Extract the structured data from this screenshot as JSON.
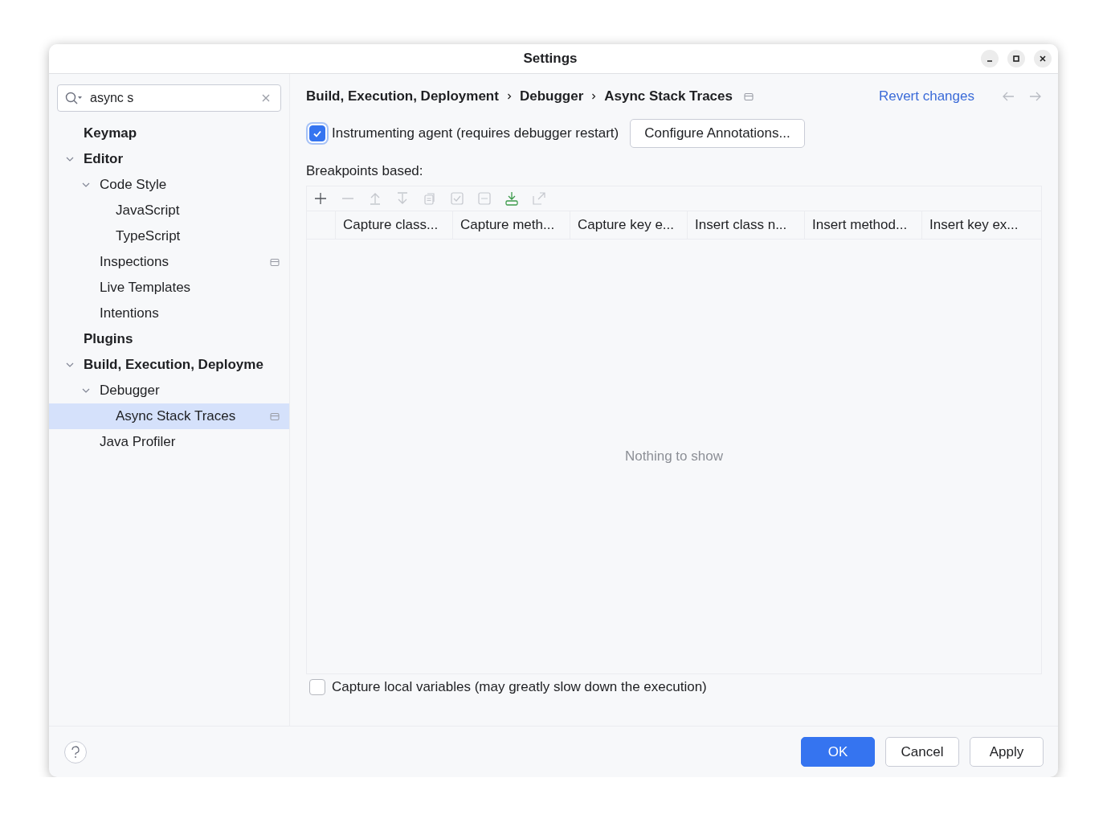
{
  "window": {
    "title": "Settings"
  },
  "search": {
    "value": "async s"
  },
  "sidebar": {
    "items": [
      {
        "label": "Keymap",
        "selected": false,
        "project_marker": false
      },
      {
        "label": "Editor",
        "selected": false,
        "project_marker": false,
        "expanded": true,
        "children": [
          {
            "label": "Code Style",
            "selected": false,
            "project_marker": false,
            "expanded": true,
            "children": [
              {
                "label": "JavaScript",
                "selected": false,
                "project_marker": false
              },
              {
                "label": "TypeScript",
                "selected": false,
                "project_marker": false
              }
            ]
          },
          {
            "label": "Inspections",
            "selected": false,
            "project_marker": true
          },
          {
            "label": "Live Templates",
            "selected": false,
            "project_marker": false
          },
          {
            "label": "Intentions",
            "selected": false,
            "project_marker": false
          }
        ]
      },
      {
        "label": "Plugins",
        "selected": false,
        "project_marker": false
      },
      {
        "label": "Build, Execution, Deployme",
        "selected": false,
        "project_marker": false,
        "expanded": true,
        "children": [
          {
            "label": "Debugger",
            "selected": false,
            "project_marker": false,
            "expanded": true,
            "children": [
              {
                "label": "Async Stack Traces",
                "selected": true,
                "project_marker": true
              }
            ]
          },
          {
            "label": "Java Profiler",
            "selected": false,
            "project_marker": false
          }
        ]
      }
    ]
  },
  "breadcrumb": {
    "items": [
      "Build, Execution, Deployment",
      "Debugger",
      "Async Stack Traces"
    ],
    "project_marker": true
  },
  "revert_link": "Revert changes",
  "nav": [
    {
      "kind": "back",
      "disabled": true
    },
    {
      "kind": "forward",
      "disabled": true
    }
  ],
  "agent_option": {
    "label": "Instrumenting agent (requires debugger restart)",
    "checked": true
  },
  "configure_button": "Configure Annotations...",
  "breakpoints_label": "Breakpoints based:",
  "toolbar": [
    {
      "kind": "add",
      "disabled": false
    },
    {
      "kind": "remove",
      "disabled": true
    },
    {
      "kind": "up",
      "disabled": true
    },
    {
      "kind": "down",
      "disabled": true
    },
    {
      "kind": "copy",
      "disabled": true
    },
    {
      "kind": "check",
      "disabled": true
    },
    {
      "kind": "uncheck",
      "disabled": true
    },
    {
      "kind": "import",
      "disabled": false
    },
    {
      "kind": "export",
      "disabled": true
    }
  ],
  "table": {
    "columns": [
      "Capture class...",
      "Capture meth...",
      "Capture key e...",
      "Insert class n...",
      "Insert method...",
      "Insert key ex..."
    ],
    "empty_text": "Nothing to show"
  },
  "locals_option": {
    "label": "Capture local variables (may greatly slow down the execution)",
    "checked": false
  },
  "buttons": [
    {
      "label": "OK",
      "primary": true
    },
    {
      "label": "Cancel",
      "primary": false
    },
    {
      "label": "Apply",
      "primary": false
    }
  ]
}
